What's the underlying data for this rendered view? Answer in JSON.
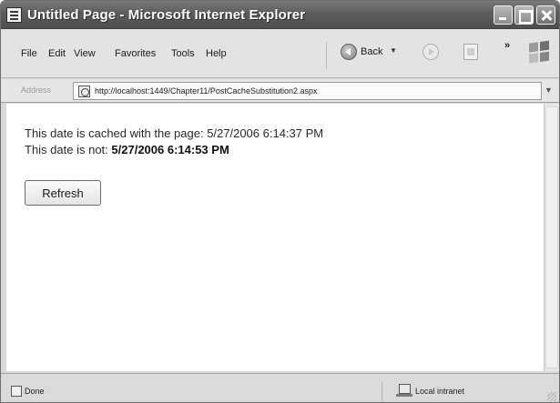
{
  "window": {
    "title": "Untitled Page - Microsoft Internet Explorer"
  },
  "menu": {
    "items": [
      "File",
      "Edit",
      "View",
      "Favorites",
      "Tools",
      "Help"
    ],
    "back_label": "Back",
    "overflow": "»"
  },
  "address": {
    "label": "Address",
    "url": "http://localhost:1449/Chapter11/PostCacheSubstitution2.aspx"
  },
  "page": {
    "cached_prefix": "This date is cached with the page:",
    "cached_date": "5/27/2006 6:14:37 PM",
    "notcached_prefix": "This date is not:",
    "notcached_date": "5/27/2006 6:14:53 PM",
    "refresh_label": "Refresh"
  },
  "status": {
    "text": "Done",
    "zone": "Local intranet"
  },
  "icons": {
    "app": "ie-page-icon",
    "back": "back-arrow-icon",
    "forward": "forward-arrow-icon",
    "stop": "stop-icon",
    "logo": "windows-flag-icon"
  }
}
